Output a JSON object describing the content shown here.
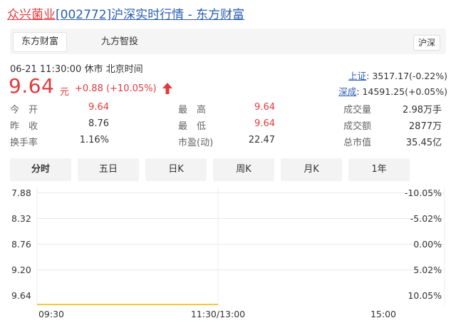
{
  "header": {
    "name": "众兴菌业",
    "code": "[002772]",
    "rest": "沪深实时行情 - 东方财富"
  },
  "tabs": {
    "items": [
      "东方财富",
      "九方智投"
    ],
    "right": "沪深"
  },
  "status": {
    "datetime": "06-21 11:30:00",
    "state": "休市",
    "timezone": "北京时间"
  },
  "quote": {
    "price": "9.64",
    "unit": "元",
    "change": "+0.88 (+10.05%)",
    "direction": "up"
  },
  "indices": [
    {
      "label": "上证",
      "value": ": 3517.17(-0.22%)"
    },
    {
      "label": "深成",
      "value": ": 14591.25(+0.05%)"
    }
  ],
  "stats": [
    {
      "label": "今　开",
      "value": "9.64",
      "color": "red"
    },
    {
      "label": "最　高",
      "value": "9.64",
      "color": "red"
    },
    {
      "label": "成交量",
      "value": "2.98万手",
      "color": "black"
    },
    {
      "label": "昨　收",
      "value": "8.76",
      "color": "black"
    },
    {
      "label": "最　低",
      "value": "9.64",
      "color": "red"
    },
    {
      "label": "成交额",
      "value": "2877万",
      "color": "black"
    },
    {
      "label": "换手率",
      "value": "1.16%",
      "color": "black"
    },
    {
      "label": "市盈(动)",
      "value": "22.47",
      "color": "black"
    },
    {
      "label": "总市值",
      "value": "35.45亿",
      "color": "black"
    }
  ],
  "period_tabs": [
    "分时",
    "五日",
    "日K",
    "周K",
    "月K",
    "1年"
  ],
  "active_period": "分时",
  "chart_data": {
    "type": "line",
    "y_left_labels": [
      "7.88",
      "8.32",
      "8.76",
      "9.20",
      "9.64"
    ],
    "y_right_labels": [
      "-10.05%",
      "-5.02%",
      "0.00%",
      "5.02%",
      "10.05%"
    ],
    "x_labels": [
      "09:30",
      "11:30/13:00",
      "15:00"
    ],
    "ylim": [
      7.88,
      9.64
    ],
    "series": [
      {
        "x": [
          "09:30",
          "11:30"
        ],
        "values": [
          9.64,
          9.64
        ]
      }
    ],
    "line_color": "#f4b400"
  }
}
